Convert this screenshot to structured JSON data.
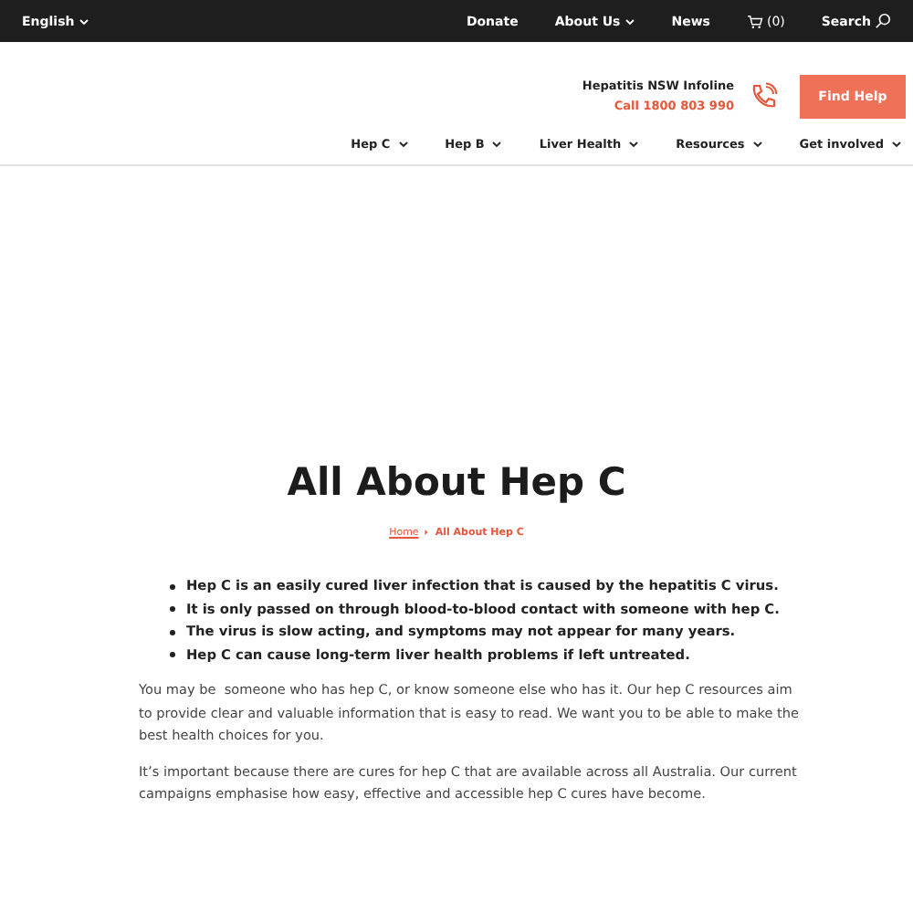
{
  "top_bar": {
    "language": "English",
    "links": [
      {
        "label": "Donate",
        "kind": "link"
      },
      {
        "label": "About Us",
        "kind": "menu"
      },
      {
        "label": "News",
        "kind": "link"
      },
      {
        "label": "(0)",
        "kind": "cart"
      },
      {
        "label": "Search",
        "kind": "search"
      }
    ]
  },
  "header": {
    "infoline_title": "Hepatitis NSW Infoline",
    "infoline_phone": "Call 1800 803 990",
    "cta": "Find Help"
  },
  "nav": [
    {
      "label": "Hep C"
    },
    {
      "label": "Hep B"
    },
    {
      "label": "Liver Health"
    },
    {
      "label": "Resources"
    },
    {
      "label": "Get involved"
    }
  ],
  "page": {
    "title": "All About Hep C",
    "breadcrumb": [
      {
        "label": "Home",
        "kind": "link"
      },
      {
        "label": "All About Hep C",
        "kind": "current"
      }
    ],
    "bullets": [
      "Hep C is an easily cured liver infection that is caused by the hepatitis C virus.",
      "It is only passed on through blood-to-blood contact with someone with hep C.",
      "The virus is slow acting, and symptoms may not appear for many years.",
      "Hep C can cause long-term liver health problems if left untreated."
    ],
    "paragraphs": [
      "You may be  someone who has hep C, or know someone else who has it. Our hep C resources aim to provide clear and valuable information that is easy to read. We want you to be able to make the best health choices for you.",
      "It’s important because there are cures for hep C that are available across all Australia. Our current campaigns emphasise how easy, effective and accessible hep C cures have become."
    ]
  }
}
